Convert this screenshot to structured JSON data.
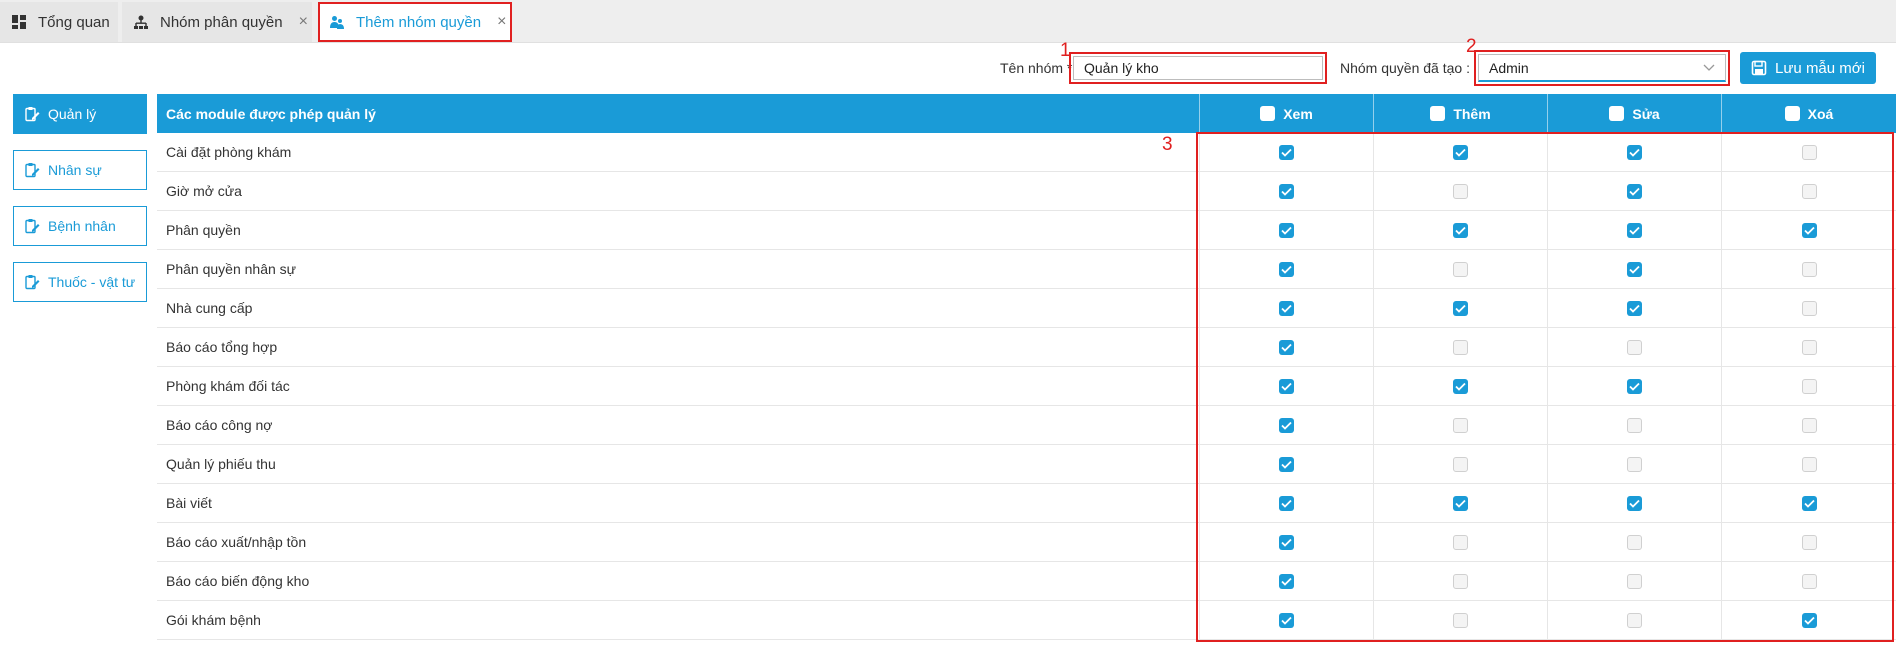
{
  "tabs": [
    {
      "label": "Tổng quan",
      "icon": "dashboard-icon",
      "closable": false,
      "active": false
    },
    {
      "label": "Nhóm phân quyền",
      "icon": "org-chart-icon",
      "closable": true,
      "active": false
    },
    {
      "label": "Thêm nhóm quyền",
      "icon": "users-icon",
      "closable": true,
      "active": true
    }
  ],
  "tab_close_glyph": "×",
  "form": {
    "name_label": "Tên nhóm *",
    "name_value": "Quản lý kho",
    "group_label": "Nhóm quyền đã tạo :",
    "group_value": "Admin",
    "save_label": "Lưu mẫu mới"
  },
  "annotations": {
    "a1": "1",
    "a2": "2",
    "a3": "3"
  },
  "sidebar": {
    "items": [
      {
        "label": "Quản lý",
        "active": true
      },
      {
        "label": "Nhân sự",
        "active": false
      },
      {
        "label": "Bệnh nhân",
        "active": false
      },
      {
        "label": "Thuốc - vật tư",
        "active": false
      }
    ]
  },
  "table": {
    "header_module": "Các module được phép quản lý",
    "columns": [
      "Xem",
      "Thêm",
      "Sửa",
      "Xoá"
    ],
    "rows": [
      {
        "name": "Cài đặt phòng khám",
        "perms": [
          true,
          true,
          true,
          false
        ]
      },
      {
        "name": "Giờ mở cửa",
        "perms": [
          true,
          false,
          true,
          false
        ]
      },
      {
        "name": "Phân quyền",
        "perms": [
          true,
          true,
          true,
          true
        ]
      },
      {
        "name": "Phân quyền nhân sự",
        "perms": [
          true,
          false,
          true,
          false
        ]
      },
      {
        "name": "Nhà cung cấp",
        "perms": [
          true,
          true,
          true,
          false
        ]
      },
      {
        "name": "Báo cáo tổng hợp",
        "perms": [
          true,
          false,
          false,
          false
        ]
      },
      {
        "name": "Phòng khám đối tác",
        "perms": [
          true,
          true,
          true,
          false
        ]
      },
      {
        "name": "Báo cáo công nợ",
        "perms": [
          true,
          false,
          false,
          false
        ]
      },
      {
        "name": "Quản lý phiếu thu",
        "perms": [
          true,
          false,
          false,
          false
        ]
      },
      {
        "name": "Bài viết",
        "perms": [
          true,
          true,
          true,
          true
        ]
      },
      {
        "name": "Báo cáo xuất/nhập tồn",
        "perms": [
          true,
          false,
          false,
          false
        ]
      },
      {
        "name": "Báo cáo biến động kho",
        "perms": [
          true,
          false,
          false,
          false
        ]
      },
      {
        "name": "Gói khám bệnh",
        "perms": [
          true,
          false,
          false,
          true
        ]
      }
    ]
  },
  "colors": {
    "accent": "#1a9bd7",
    "annotation": "#e02020"
  }
}
